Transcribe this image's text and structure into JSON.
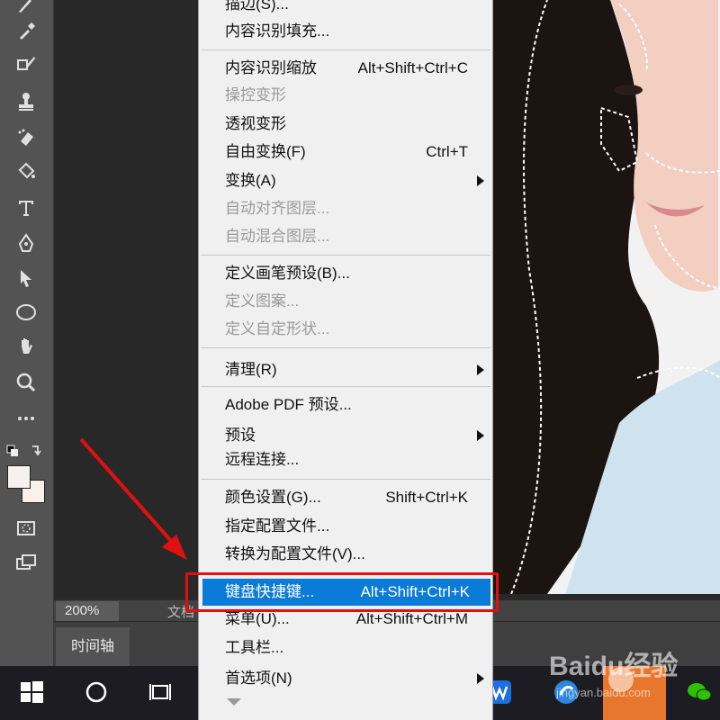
{
  "status": {
    "zoom": "200%",
    "doc_info": "文档"
  },
  "panel_tabs": {
    "timeline": "时间轴"
  },
  "menu": {
    "items": [
      {
        "label": "描边(S)...",
        "shortcut": "",
        "submenu": false,
        "disabled": false
      },
      {
        "label": "内容识别填充...",
        "shortcut": "",
        "submenu": false,
        "disabled": false
      },
      {
        "label": "内容识别缩放",
        "shortcut": "Alt+Shift+Ctrl+C",
        "submenu": false,
        "disabled": false
      },
      {
        "label": "操控变形",
        "shortcut": "",
        "submenu": false,
        "disabled": true
      },
      {
        "label": "透视变形",
        "shortcut": "",
        "submenu": false,
        "disabled": false
      },
      {
        "label": "自由变换(F)",
        "shortcut": "Ctrl+T",
        "submenu": false,
        "disabled": false
      },
      {
        "label": "变换(A)",
        "shortcut": "",
        "submenu": true,
        "disabled": false
      },
      {
        "label": "自动对齐图层...",
        "shortcut": "",
        "submenu": false,
        "disabled": true
      },
      {
        "label": "自动混合图层...",
        "shortcut": "",
        "submenu": false,
        "disabled": true
      },
      {
        "label": "定义画笔预设(B)...",
        "shortcut": "",
        "submenu": false,
        "disabled": false
      },
      {
        "label": "定义图案...",
        "shortcut": "",
        "submenu": false,
        "disabled": true
      },
      {
        "label": "定义自定形状...",
        "shortcut": "",
        "submenu": false,
        "disabled": true
      },
      {
        "label": "清理(R)",
        "shortcut": "",
        "submenu": true,
        "disabled": false
      },
      {
        "label": "Adobe PDF 预设...",
        "shortcut": "",
        "submenu": false,
        "disabled": false
      },
      {
        "label": "预设",
        "shortcut": "",
        "submenu": true,
        "disabled": false
      },
      {
        "label": "远程连接...",
        "shortcut": "",
        "submenu": false,
        "disabled": false
      },
      {
        "label": "颜色设置(G)...",
        "shortcut": "Shift+Ctrl+K",
        "submenu": false,
        "disabled": false
      },
      {
        "label": "指定配置文件...",
        "shortcut": "",
        "submenu": false,
        "disabled": false
      },
      {
        "label": "转换为配置文件(V)...",
        "shortcut": "",
        "submenu": false,
        "disabled": false
      },
      {
        "label": "键盘快捷键...",
        "shortcut": "Alt+Shift+Ctrl+K",
        "submenu": false,
        "disabled": false,
        "highlighted": true
      },
      {
        "label": "菜单(U)...",
        "shortcut": "Alt+Shift+Ctrl+M",
        "submenu": false,
        "disabled": false
      },
      {
        "label": "工具栏...",
        "shortcut": "",
        "submenu": false,
        "disabled": false
      },
      {
        "label": "首选项(N)",
        "shortcut": "",
        "submenu": true,
        "disabled": false
      }
    ]
  },
  "watermark": {
    "brand": "Baidu经验",
    "url": "jingyan.baidu.com"
  },
  "colors": {
    "highlight": "#0a7bd6",
    "annotation_red": "#e01010",
    "menu_bg": "#f0f0f0",
    "toolbar_bg": "#535353"
  }
}
